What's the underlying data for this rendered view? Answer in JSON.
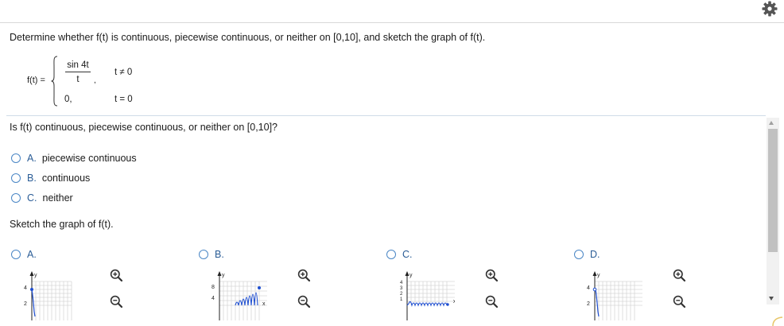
{
  "question": {
    "prompt": "Determine whether f(t) is continuous, piecewise continuous, or neither on [0,10], and sketch the graph of f(t).",
    "function": {
      "label": "f(t) =",
      "numerator": "sin 4t",
      "denominator": "t",
      "comma": ",",
      "condition1": "t ≠ 0",
      "value2": "0,",
      "condition2": "t = 0"
    },
    "sub_question": "Is f(t) continuous, piecewise continuous, or neither on [0,10]?",
    "choices": [
      {
        "letter": "A.",
        "text": "piecewise continuous"
      },
      {
        "letter": "B.",
        "text": "continuous"
      },
      {
        "letter": "C.",
        "text": "neither"
      }
    ],
    "sketch_prompt": "Sketch the graph of f(t).",
    "graph_options": [
      {
        "letter": "A.",
        "y_ticks": [
          "4",
          "2"
        ],
        "axis_y": "y",
        "axis_x": ""
      },
      {
        "letter": "B.",
        "y_ticks": [
          "8",
          "4"
        ],
        "axis_y": "y",
        "axis_x": "x"
      },
      {
        "letter": "C.",
        "y_ticks": [
          "4",
          "3",
          "2",
          "1"
        ],
        "axis_y": "y",
        "axis_x": "x"
      },
      {
        "letter": "D.",
        "y_ticks": [
          "4",
          "2"
        ],
        "axis_y": "y",
        "axis_x": ""
      }
    ]
  },
  "icons": {
    "settings": "gear-icon",
    "zoom_in": "zoom-in-icon",
    "zoom_out": "zoom-out-icon"
  },
  "colors": {
    "accent": "#2a5c96",
    "radio": "#4a86c5",
    "graph_blue": "#1f4fd1"
  }
}
